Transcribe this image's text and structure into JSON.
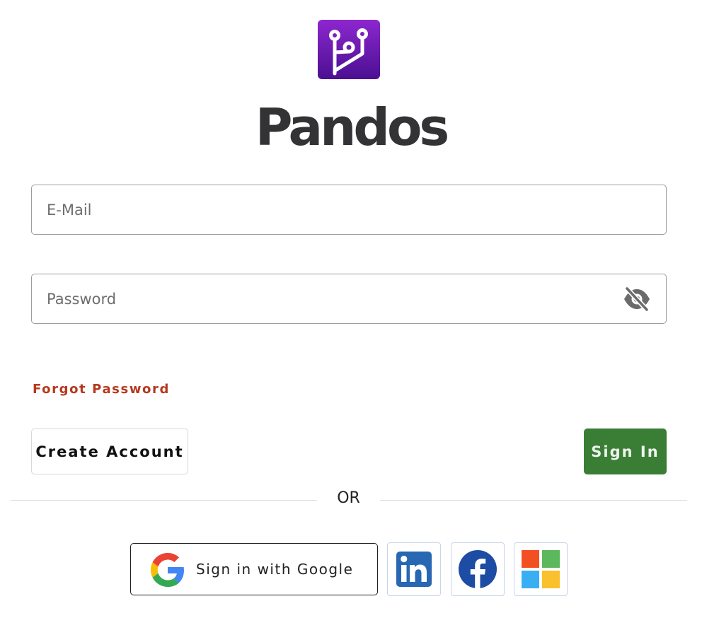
{
  "brand": {
    "name": "Pandos",
    "logo_icon": "pandos-logo-icon",
    "logo_gradient": [
      "#8d27cf",
      "#4b0f91"
    ]
  },
  "form": {
    "email_placeholder": "E-Mail",
    "email_value": "",
    "password_placeholder": "Password",
    "password_value": "",
    "toggle_visibility_icon": "eye-off-icon",
    "forgot_password_label": "Forgot Password"
  },
  "actions": {
    "create_account_label": "Create Account",
    "sign_in_label": "Sign In",
    "sign_in_color": "#3a7e35",
    "forgot_color": "#b5381d"
  },
  "divider": {
    "label": "OR"
  },
  "social": {
    "google_label": "Sign in with Google",
    "google_icon": "google-icon",
    "providers": [
      "linkedin-icon",
      "facebook-icon",
      "microsoft-icon"
    ]
  }
}
